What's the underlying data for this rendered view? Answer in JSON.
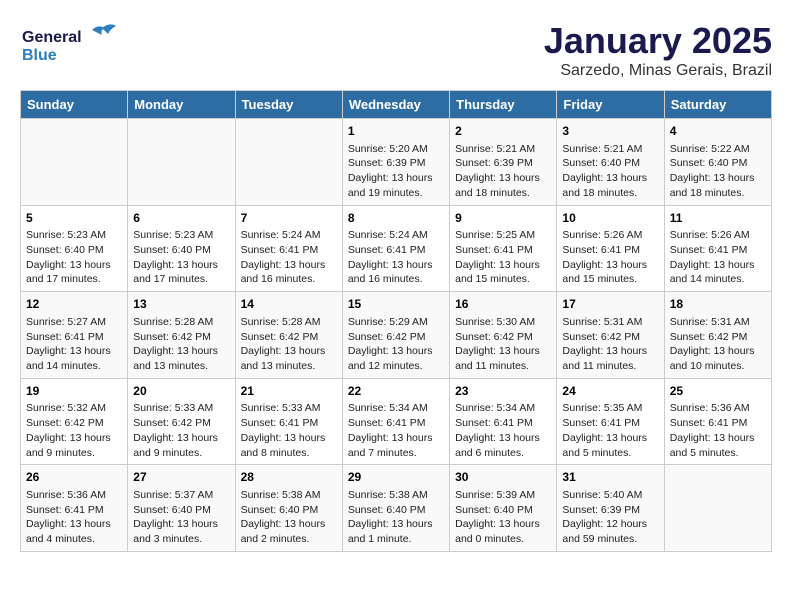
{
  "logo": {
    "line1": "General",
    "line2": "Blue",
    "tagline": ""
  },
  "title": "January 2025",
  "subtitle": "Sarzedo, Minas Gerais, Brazil",
  "days_of_week": [
    "Sunday",
    "Monday",
    "Tuesday",
    "Wednesday",
    "Thursday",
    "Friday",
    "Saturday"
  ],
  "weeks": [
    [
      {
        "day": "",
        "info": ""
      },
      {
        "day": "",
        "info": ""
      },
      {
        "day": "",
        "info": ""
      },
      {
        "day": "1",
        "info": "Sunrise: 5:20 AM\nSunset: 6:39 PM\nDaylight: 13 hours\nand 19 minutes."
      },
      {
        "day": "2",
        "info": "Sunrise: 5:21 AM\nSunset: 6:39 PM\nDaylight: 13 hours\nand 18 minutes."
      },
      {
        "day": "3",
        "info": "Sunrise: 5:21 AM\nSunset: 6:40 PM\nDaylight: 13 hours\nand 18 minutes."
      },
      {
        "day": "4",
        "info": "Sunrise: 5:22 AM\nSunset: 6:40 PM\nDaylight: 13 hours\nand 18 minutes."
      }
    ],
    [
      {
        "day": "5",
        "info": "Sunrise: 5:23 AM\nSunset: 6:40 PM\nDaylight: 13 hours\nand 17 minutes."
      },
      {
        "day": "6",
        "info": "Sunrise: 5:23 AM\nSunset: 6:40 PM\nDaylight: 13 hours\nand 17 minutes."
      },
      {
        "day": "7",
        "info": "Sunrise: 5:24 AM\nSunset: 6:41 PM\nDaylight: 13 hours\nand 16 minutes."
      },
      {
        "day": "8",
        "info": "Sunrise: 5:24 AM\nSunset: 6:41 PM\nDaylight: 13 hours\nand 16 minutes."
      },
      {
        "day": "9",
        "info": "Sunrise: 5:25 AM\nSunset: 6:41 PM\nDaylight: 13 hours\nand 15 minutes."
      },
      {
        "day": "10",
        "info": "Sunrise: 5:26 AM\nSunset: 6:41 PM\nDaylight: 13 hours\nand 15 minutes."
      },
      {
        "day": "11",
        "info": "Sunrise: 5:26 AM\nSunset: 6:41 PM\nDaylight: 13 hours\nand 14 minutes."
      }
    ],
    [
      {
        "day": "12",
        "info": "Sunrise: 5:27 AM\nSunset: 6:41 PM\nDaylight: 13 hours\nand 14 minutes."
      },
      {
        "day": "13",
        "info": "Sunrise: 5:28 AM\nSunset: 6:42 PM\nDaylight: 13 hours\nand 13 minutes."
      },
      {
        "day": "14",
        "info": "Sunrise: 5:28 AM\nSunset: 6:42 PM\nDaylight: 13 hours\nand 13 minutes."
      },
      {
        "day": "15",
        "info": "Sunrise: 5:29 AM\nSunset: 6:42 PM\nDaylight: 13 hours\nand 12 minutes."
      },
      {
        "day": "16",
        "info": "Sunrise: 5:30 AM\nSunset: 6:42 PM\nDaylight: 13 hours\nand 11 minutes."
      },
      {
        "day": "17",
        "info": "Sunrise: 5:31 AM\nSunset: 6:42 PM\nDaylight: 13 hours\nand 11 minutes."
      },
      {
        "day": "18",
        "info": "Sunrise: 5:31 AM\nSunset: 6:42 PM\nDaylight: 13 hours\nand 10 minutes."
      }
    ],
    [
      {
        "day": "19",
        "info": "Sunrise: 5:32 AM\nSunset: 6:42 PM\nDaylight: 13 hours\nand 9 minutes."
      },
      {
        "day": "20",
        "info": "Sunrise: 5:33 AM\nSunset: 6:42 PM\nDaylight: 13 hours\nand 9 minutes."
      },
      {
        "day": "21",
        "info": "Sunrise: 5:33 AM\nSunset: 6:41 PM\nDaylight: 13 hours\nand 8 minutes."
      },
      {
        "day": "22",
        "info": "Sunrise: 5:34 AM\nSunset: 6:41 PM\nDaylight: 13 hours\nand 7 minutes."
      },
      {
        "day": "23",
        "info": "Sunrise: 5:34 AM\nSunset: 6:41 PM\nDaylight: 13 hours\nand 6 minutes."
      },
      {
        "day": "24",
        "info": "Sunrise: 5:35 AM\nSunset: 6:41 PM\nDaylight: 13 hours\nand 5 minutes."
      },
      {
        "day": "25",
        "info": "Sunrise: 5:36 AM\nSunset: 6:41 PM\nDaylight: 13 hours\nand 5 minutes."
      }
    ],
    [
      {
        "day": "26",
        "info": "Sunrise: 5:36 AM\nSunset: 6:41 PM\nDaylight: 13 hours\nand 4 minutes."
      },
      {
        "day": "27",
        "info": "Sunrise: 5:37 AM\nSunset: 6:40 PM\nDaylight: 13 hours\nand 3 minutes."
      },
      {
        "day": "28",
        "info": "Sunrise: 5:38 AM\nSunset: 6:40 PM\nDaylight: 13 hours\nand 2 minutes."
      },
      {
        "day": "29",
        "info": "Sunrise: 5:38 AM\nSunset: 6:40 PM\nDaylight: 13 hours\nand 1 minute."
      },
      {
        "day": "30",
        "info": "Sunrise: 5:39 AM\nSunset: 6:40 PM\nDaylight: 13 hours\nand 0 minutes."
      },
      {
        "day": "31",
        "info": "Sunrise: 5:40 AM\nSunset: 6:39 PM\nDaylight: 12 hours\nand 59 minutes."
      },
      {
        "day": "",
        "info": ""
      }
    ]
  ]
}
